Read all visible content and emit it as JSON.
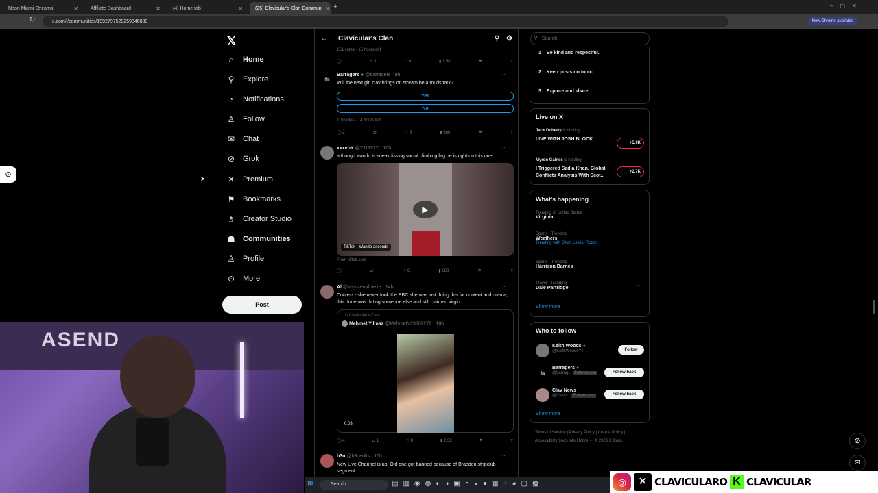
{
  "browser": {
    "tabs": [
      {
        "label": "Neon Miami Streams"
      },
      {
        "label": "Affiliate Dashboard"
      },
      {
        "label": "(4) Home tab"
      },
      {
        "label": "(25) Clavicular's Clan Communi"
      }
    ],
    "url": "x.com/i/communities/1992797520259346880",
    "new_chrome": "New Chrome available"
  },
  "nav": {
    "items": [
      {
        "label": "Home",
        "icon": "⌂"
      },
      {
        "label": "Explore",
        "icon": "⚲"
      },
      {
        "label": "Notifications",
        "icon": "🔔"
      },
      {
        "label": "Follow",
        "icon": "👤"
      },
      {
        "label": "Chat",
        "icon": "✉"
      },
      {
        "label": "Grok",
        "icon": "⊘"
      },
      {
        "label": "Premium",
        "icon": "✕"
      },
      {
        "label": "Bookmarks",
        "icon": "⚑"
      },
      {
        "label": "Creator Studio",
        "icon": "♙"
      },
      {
        "label": "Communities",
        "icon": "👥"
      },
      {
        "label": "Profile",
        "icon": "👤"
      },
      {
        "label": "More",
        "icon": "⋯"
      }
    ],
    "post": "Post"
  },
  "feed": {
    "title": "Clavicular's Clan",
    "top_votes": "151 votes · 15 hours left",
    "top_stats": {
      "retweets": "3",
      "likes": "6",
      "views": "1.5K"
    },
    "t1": {
      "name": "Barragers",
      "handle": "@barragers · 9h",
      "text": "Will the next girl clav brings on stream be a mudshark?",
      "opt1": "Yes",
      "opt2": "No",
      "votes": "110 votes · 14 hours left",
      "replies": "2",
      "likes": "3",
      "views": "680"
    },
    "t2": {
      "name": "xxxehY",
      "handle": "@Y11197Y · 10h",
      "text": "although wando is sneakdissing social climbing fag he is right on this one",
      "badge": "TikTok · Wando ascends",
      "source": "From tiktok.com",
      "likes": "6",
      "views": "683"
    },
    "t3": {
      "name": "Al",
      "handle": "@alsystemdotexe · 14h",
      "text": "Context - she never took the BBC she was just doing this for content and drama, this dude was dating someone else and still claimed virgin",
      "quote_comm": "Clavicular's Clan",
      "quote_name": "Mehmet Yilmaz",
      "quote_handle": "@MehmetY29389279 · 18h",
      "duration": "0:03",
      "replies": "4",
      "retweets": "1",
      "likes": "8",
      "views": "2.3K"
    },
    "t4": {
      "name": "b3n",
      "handle": "@b3nedits · 16h",
      "text": "New Live Channel is up! Old one got banned because of Braeden stripclub segment"
    }
  },
  "right": {
    "search_placeholder": "Search",
    "rules": [
      {
        "n": "1",
        "t": "Be kind and respectful."
      },
      {
        "n": "2",
        "t": "Keep posts on topic."
      },
      {
        "n": "3",
        "t": "Explore and share."
      }
    ],
    "live_title": "Live on X",
    "live": [
      {
        "host": "Jack Doherty",
        "status": "is hosting",
        "title": "LIVE WITH JOSH BLOCK",
        "count": "+5.9K"
      },
      {
        "host": "Myron Gaines",
        "status": "is hosting",
        "title": "I Triggered Sadia Khan, Global Conflicts Analysis With Scot...",
        "count": "+2.7K"
      }
    ],
    "happening_title": "What's happening",
    "trends": [
      {
        "meta": "Trending in United States",
        "name": "Virginia",
        "extra": ""
      },
      {
        "meta": "Sports · Trending",
        "name": "Weathers",
        "extra": "Trending with Dillon Lewis, Rodon"
      },
      {
        "meta": "Sports · Trending",
        "name": "Harrison Barnes",
        "extra": ""
      },
      {
        "meta": "Travel · Trending",
        "name": "Dale Partridge",
        "extra": ""
      }
    ],
    "show_more": "Show more",
    "wtf_title": "Who to follow",
    "wtf": [
      {
        "name": "Keith Woods",
        "handle": "@KeithWoodsYT",
        "btn": "Follow",
        "tag": ""
      },
      {
        "name": "Barragers",
        "handle": "@barrag...",
        "btn": "Follow back",
        "tag": "Follows you"
      },
      {
        "name": "Clav News",
        "handle": "@Clavn...",
        "btn": "Follow back",
        "tag": "Follows you"
      }
    ],
    "footer1": "Terms of Service | Privacy Policy | Cookie Policy |",
    "footer2": "Accessibility | Ads info | More ··· © 2026 X Corp."
  },
  "webcam_text": "ASEND",
  "taskbar_search": "Search",
  "brand": {
    "name1": "CLAVICULARO",
    "k": "K",
    "name2": "CLAVICULAR"
  }
}
